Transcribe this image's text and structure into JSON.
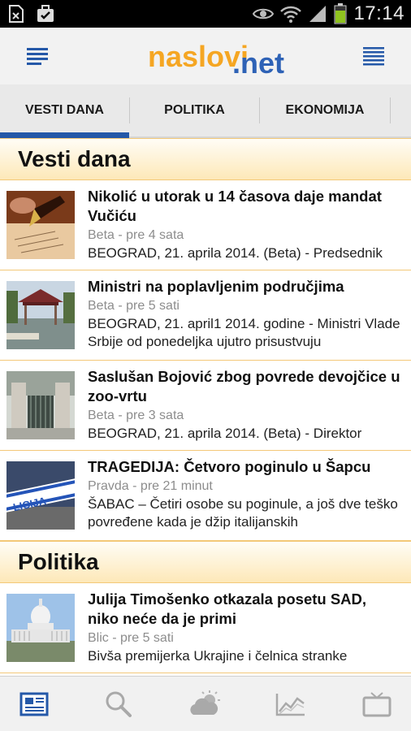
{
  "status_bar": {
    "time": "17:14"
  },
  "app_bar": {
    "logo_part1": "naslovi",
    "logo_part2": ".net"
  },
  "tabs": [
    {
      "label": "VESTI DANA",
      "active": true
    },
    {
      "label": "POLITIKA",
      "active": false
    },
    {
      "label": "EKONOMIJA",
      "active": false
    }
  ],
  "sections": [
    {
      "title": "Vesti dana",
      "articles": [
        {
          "title": "Nikolić u utorak u 14 časova daje mandat Vučiću",
          "source": "Beta",
          "time": "pre 4 sata",
          "summary": "BEOGRAD, 21. aprila 2014. (Beta) - Predsednik",
          "thumb": "pen-writing"
        },
        {
          "title": "Ministri na poplavljenim područjima",
          "source": "Beta",
          "time": "pre 5 sati",
          "summary": "BEOGRAD, 21. april1 2014. godine - Ministri Vlade Srbije od ponedeljka ujutro prisustvuju",
          "thumb": "flooded-gazebo"
        },
        {
          "title": "Saslušan Bojović zbog povrede devojčice u zoo-vrtu",
          "source": "Beta",
          "time": "pre 3 sata",
          "summary": "BEOGRAD, 21. aprila 2014. (Beta) - Direktor",
          "thumb": "zoo-gate"
        },
        {
          "title": "TRAGEDIJA: Četvoro poginulo u Šapcu",
          "source": "Pravda",
          "time": "pre 21 minut",
          "summary": "ŠABAC – Četiri osobe su poginule, a još dve teško povređene kada je džip italijanskih",
          "thumb": "police-tape"
        }
      ]
    },
    {
      "title": "Politika",
      "articles": [
        {
          "title": "Julija Timošenko otkazala posetu SAD, niko neće da je primi",
          "source": "Blic",
          "time": "pre 5 sati",
          "summary": "Bivša premijerka Ukrajine i čelnica stranke",
          "thumb": "capitol"
        }
      ]
    }
  ],
  "bottom_nav": [
    {
      "icon": "news-icon",
      "active": true
    },
    {
      "icon": "search-icon",
      "active": false
    },
    {
      "icon": "weather-icon",
      "active": false
    },
    {
      "icon": "chart-icon",
      "active": false
    },
    {
      "icon": "tv-icon",
      "active": false
    }
  ],
  "colors": {
    "accent": "#2458a8",
    "logo_orange": "#f5a623",
    "logo_blue": "#2e62b6",
    "section_border": "#f3c878",
    "meta_gray": "#8d8d8d"
  }
}
